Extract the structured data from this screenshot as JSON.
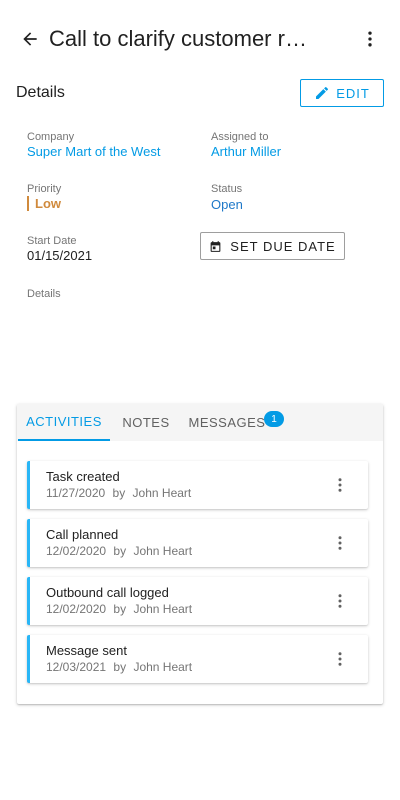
{
  "appbar": {
    "title": "Call to clarify customer r…",
    "back_icon": "arrow-back-icon",
    "more_icon": "more-vertical-icon"
  },
  "details": {
    "heading": "Details",
    "edit_label": "Edit",
    "company": {
      "label": "Company",
      "value": "Super Mart of the West"
    },
    "assigned": {
      "label": "Assigned to",
      "value": "Arthur Miller"
    },
    "priority": {
      "label": "Priority",
      "value": "Low"
    },
    "status": {
      "label": "Status",
      "value": "Open"
    },
    "start_date": {
      "label": "Start Date",
      "value": "01/15/2021"
    },
    "due_button_label": "Set Due Date",
    "details_field": {
      "label": "Details",
      "value": ""
    }
  },
  "tabs": [
    {
      "label": "Activities"
    },
    {
      "label": "Notes"
    },
    {
      "label": "Messages",
      "badge": "1"
    }
  ],
  "activities": [
    {
      "title": "Task created",
      "date": "11/27/2020",
      "by": "by",
      "author": "John Heart"
    },
    {
      "title": "Call planned",
      "date": "12/02/2020",
      "by": "by",
      "author": "John Heart"
    },
    {
      "title": "Outbound call logged",
      "date": "12/02/2020",
      "by": "by",
      "author": "John Heart"
    },
    {
      "title": "Message sent",
      "date": "12/03/2021",
      "by": "by",
      "author": "John Heart"
    }
  ],
  "colors": {
    "accent": "#039be5",
    "priority_low": "#d08a3c",
    "status_open": "#1e78c8"
  }
}
